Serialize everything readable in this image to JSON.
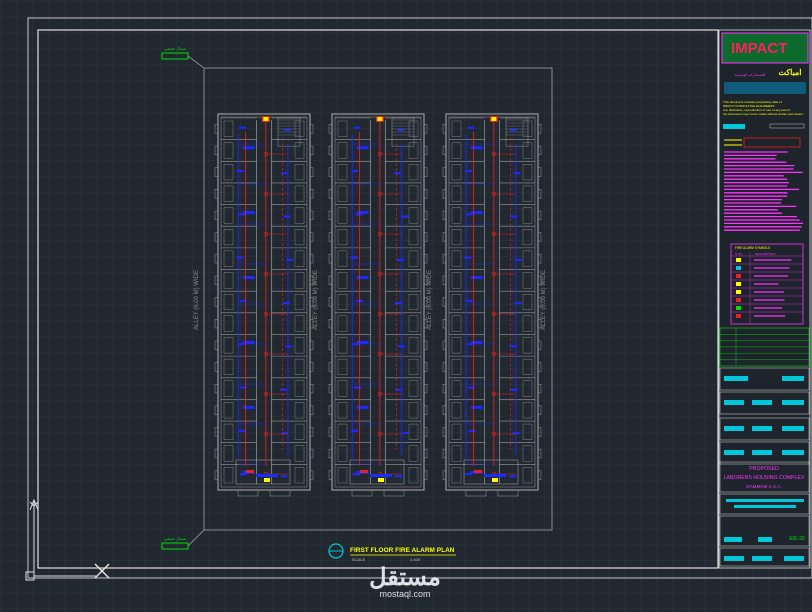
{
  "colors": {
    "background": "#212830",
    "grid": "#2b333c",
    "frame": "#d8d8d8",
    "wall": "#9a9a9a",
    "fire_line": "#e8201e",
    "device_line": "#1a2bff",
    "title_green": "#00e000",
    "title_magenta": "#ff33ff",
    "title_cyan": "#00c8d8",
    "title_yellow": "#ffff00"
  },
  "drawing": {
    "alley_labels": [
      "ALLEY (6.00 M) WIDE",
      "ALLEY (6.00 M) WIDE",
      "ALLEY (6.00 M) WIDE"
    ],
    "plan_title": "FIRST FLOOR FIRE ALARM PLAN",
    "plan_scale": "SCALE",
    "plan_scale_value": "1:100",
    "north_tags": [
      "شمال حقيقي",
      "شمال حقيقي"
    ]
  },
  "title_block": {
    "logo": "IMPACT",
    "arabic_logo": "امباكت",
    "arabic_sub": "للاستشارات الهندسية",
    "notice_lines": [
      "This document contains proprietary data of",
      "IMPACT CONSULTING ENGINEERS",
      "any disclosure, reproduction or use of any part of",
      "the document may not be made without written permission."
    ],
    "legend_title": "FIRE ALARM SYMBOLS",
    "legend_header": [
      "SYM",
      "DESCRIPTION"
    ],
    "project_lines": [
      "PROPOSED",
      "LABORERS HOUSING COMPLEX",
      "DAMMAM K.S.A."
    ],
    "sheet_no": "E/E-20"
  },
  "icons": {
    "ucs": "ucs-axis-icon",
    "cursor": "crosshair-cursor-icon"
  },
  "watermark": {
    "arabic": "مستقل",
    "latin": "mostaql.com"
  }
}
